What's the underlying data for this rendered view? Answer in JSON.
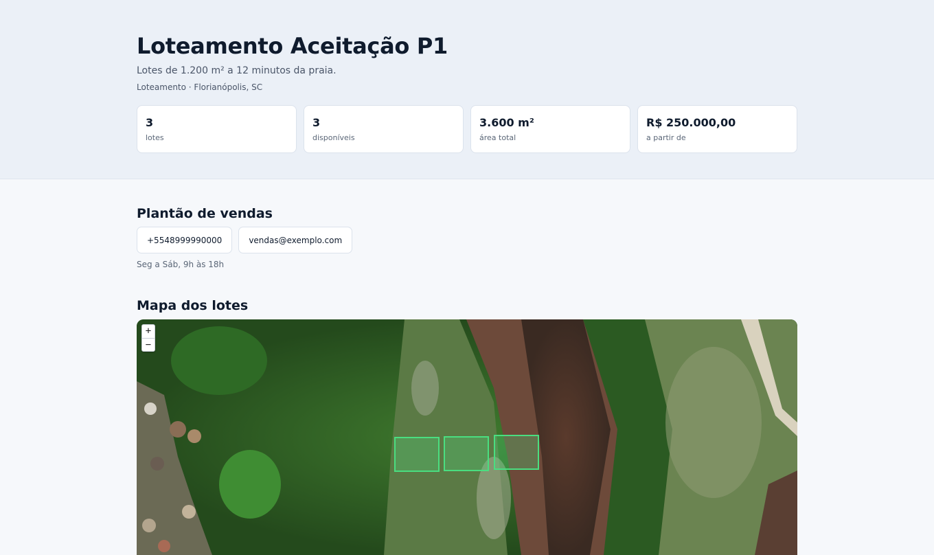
{
  "header": {
    "title": "Loteamento Aceitação P1",
    "subtitle": "Lotes de 1.200 m² a 12 minutos da praia.",
    "meta": "Loteamento · Florianópolis, SC"
  },
  "stats": [
    {
      "value": "3",
      "label": "lotes"
    },
    {
      "value": "3",
      "label": "disponíveis"
    },
    {
      "value": "3.600 m²",
      "label": "área total"
    },
    {
      "value": "R$ 250.000,00",
      "label": "a partir de"
    }
  ],
  "sales": {
    "heading": "Plantão de vendas",
    "phone": "+5548999990000",
    "email": "vendas@exemplo.com",
    "hours": "Seg a Sáb, 9h às 18h"
  },
  "map": {
    "heading": "Mapa dos lotes",
    "zoom_in": "+",
    "zoom_out": "−",
    "lot_color": "#4ade80",
    "lots_count": 3
  }
}
